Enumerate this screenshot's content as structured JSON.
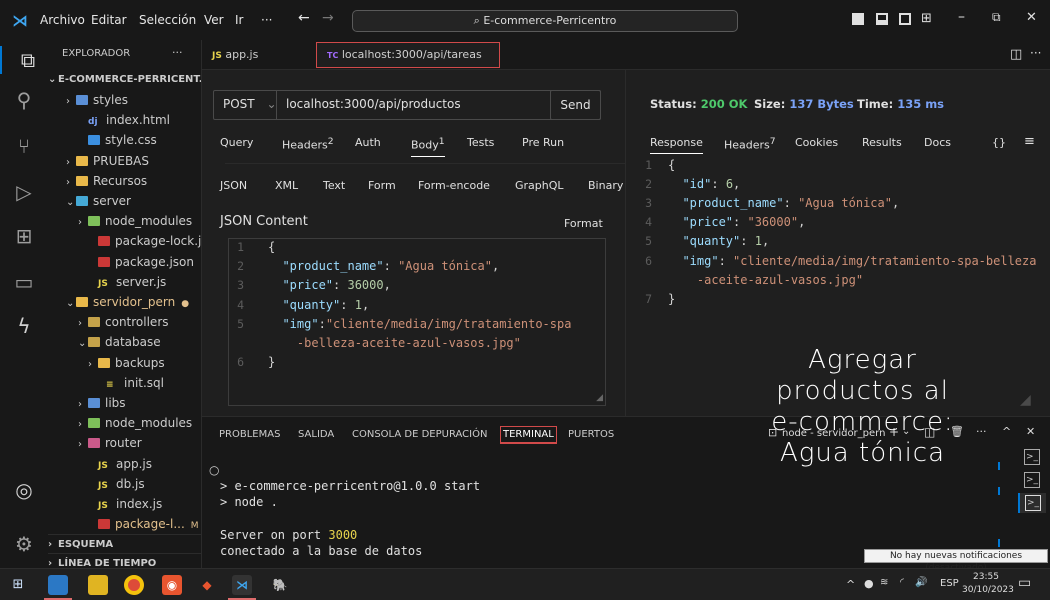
{
  "titlebar": {
    "menus": [
      "Archivo",
      "Editar",
      "Selección",
      "Ver",
      "Ir",
      "···"
    ],
    "search": "E-commerce-Perricentro",
    "nav_back": "←",
    "nav_forward": "→"
  },
  "sidebar": {
    "header": "EXPLORADOR",
    "header_more": "···",
    "root": "E-COMMERCE-PERRICENT...",
    "items": [
      {
        "label": "styles",
        "chev": "›",
        "icon_color": "#5a8fd6"
      },
      {
        "label": "index.html",
        "icon_text": "dj",
        "icon_color": "#7aa2f7"
      },
      {
        "label": "style.css",
        "icon_color": "#3b8fe0"
      },
      {
        "label": "PRUEBAS",
        "chev": "›",
        "icon_color": "#e8b84a"
      },
      {
        "label": "Recursos",
        "chev": "›",
        "icon_color": "#e8b84a"
      },
      {
        "label": "server",
        "chev": "⌄",
        "icon_color": "#45a9d6"
      },
      {
        "label": "node_modules",
        "chev": "›",
        "icon_color": "#7ec05a"
      },
      {
        "label": "package-lock.json",
        "icon_color": "#cb3837"
      },
      {
        "label": "package.json",
        "icon_color": "#cb3837"
      },
      {
        "label": "server.js",
        "icon_text": "JS",
        "icon_color": "#e8d44d"
      },
      {
        "label": "servidor_pern",
        "chev": "⌄",
        "icon_color": "#e8b84a",
        "badge": "●"
      },
      {
        "label": "controllers",
        "chev": "›",
        "icon_color": "#c4a24a"
      },
      {
        "label": "database",
        "chev": "⌄",
        "icon_color": "#c4a24a"
      },
      {
        "label": "backups",
        "chev": "›",
        "icon_color": "#e8b84a"
      },
      {
        "label": "init.sql",
        "icon_text": "≡",
        "icon_color": "#e8d44d"
      },
      {
        "label": "libs",
        "chev": "›",
        "icon_color": "#5a8fd6"
      },
      {
        "label": "node_modules",
        "chev": "›",
        "icon_color": "#7ec05a"
      },
      {
        "label": "router",
        "chev": "›",
        "icon_color": "#cb5a8a"
      },
      {
        "label": "app.js",
        "icon_text": "JS",
        "icon_color": "#e8d44d"
      },
      {
        "label": "db.js",
        "icon_text": "JS",
        "icon_color": "#e8d44d"
      },
      {
        "label": "index.js",
        "icon_text": "JS",
        "icon_color": "#e8d44d"
      },
      {
        "label": "package-l...",
        "icon_color": "#cb3837",
        "badge": "M"
      }
    ],
    "footer_sections": [
      "ESQUEMA",
      "LÍNEA DE TIEMPO"
    ]
  },
  "tabs": [
    {
      "label": "app.js",
      "icon": "JS"
    },
    {
      "label": "localhost:3000/api/tareas",
      "icon": "TC",
      "close": "✕"
    }
  ],
  "request": {
    "method": "POST",
    "url": "localhost:3000/api/productos",
    "send": "Send",
    "tabs": [
      "Query",
      "Headers",
      "Auth",
      "Body",
      "Tests",
      "Pre Run"
    ],
    "headers_count": "2",
    "body_count": "1",
    "body_types": [
      "JSON",
      "XML",
      "Text",
      "Form",
      "Form-encode",
      "GraphQL",
      "Binary"
    ],
    "content_label": "JSON Content",
    "format": "Format",
    "line_numbers": [
      "1",
      "2",
      "3",
      "4",
      "5",
      "",
      "6"
    ],
    "code_lines": [
      "{",
      "  \"product_name\": \"Agua tónica\",",
      "  \"price\": 36000,",
      "  \"quanty\": 1,",
      "  \"img\":\"cliente/media/img/tratamiento-spa",
      "    -belleza-aceite-azul-vasos.jpg\"",
      "}"
    ]
  },
  "response": {
    "status_label": "Status:",
    "status_value": "200 OK",
    "size_label": "Size:",
    "size_value": "137 Bytes",
    "time_label": "Time:",
    "time_value": "135 ms",
    "tabs": [
      "Response",
      "Headers",
      "Cookies",
      "Results",
      "Docs",
      "{}",
      "≡"
    ],
    "headers_count": "7",
    "line_numbers": [
      "1",
      "2",
      "3",
      "4",
      "5",
      "6",
      "",
      "7"
    ],
    "code_lines": [
      "{",
      "  \"id\": 6,",
      "  \"product_name\": \"Agua tónica\",",
      "  \"price\": \"36000\",",
      "  \"quanty\": 1,",
      "  \"img\": \"cliente/media/img/tratamiento-spa-belleza",
      "    -aceite-azul-vasos.jpg\"",
      "}"
    ]
  },
  "panel": {
    "tabs": [
      "PROBLEMAS",
      "SALIDA",
      "CONSOLA DE DEPURACIÓN",
      "TERMINAL",
      "PUERTOS"
    ],
    "terminal_name": "node - servidor_pern",
    "terminal_lines": [
      "> e-commerce-perricentro@1.0.0 start",
      "> node .",
      "",
      "Server on port 3000",
      "conectado a la base de datos"
    ],
    "port_number": "3000"
  },
  "overlay": {
    "lines": [
      "Agregar",
      "productos al",
      "e-commerce:",
      "Agua tónica"
    ]
  },
  "notification": "No hay nuevas notificaciones (desactivado)",
  "taskbar": {
    "time": "23:55",
    "date": "30/10/2023",
    "lang": "ESP"
  }
}
